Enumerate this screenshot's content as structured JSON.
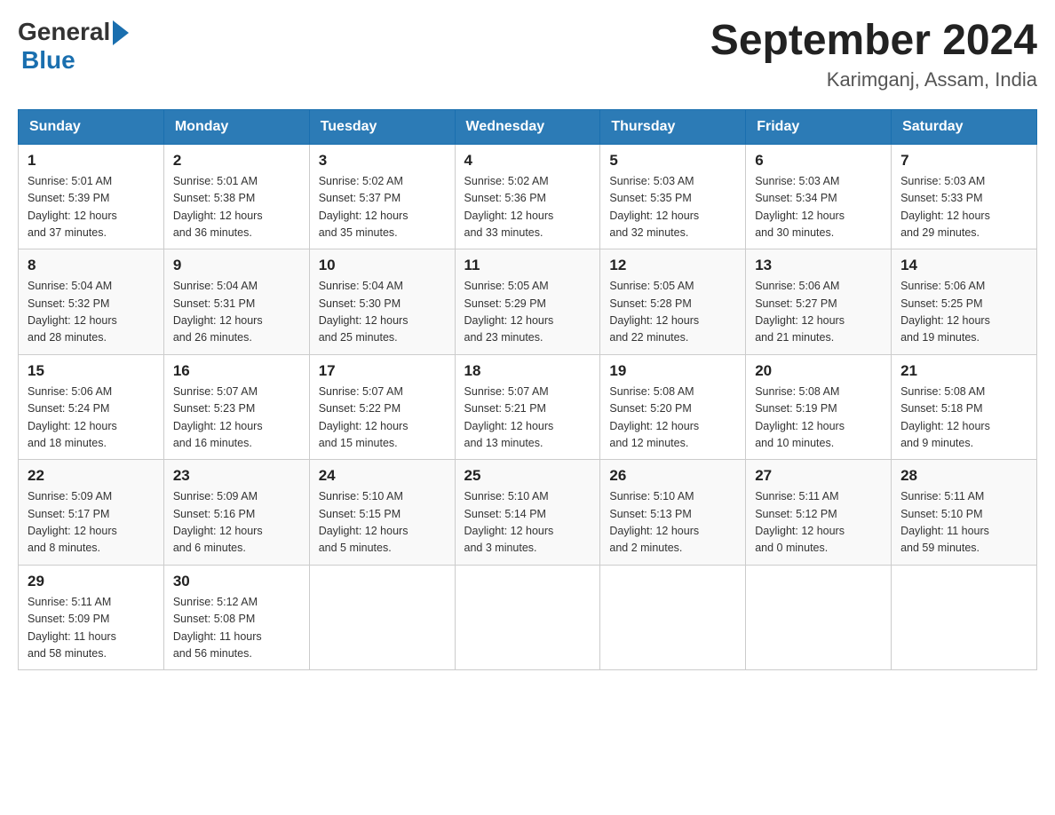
{
  "header": {
    "logo_general": "General",
    "logo_blue": "Blue",
    "month_title": "September 2024",
    "location": "Karimganj, Assam, India"
  },
  "days_of_week": [
    "Sunday",
    "Monday",
    "Tuesday",
    "Wednesday",
    "Thursday",
    "Friday",
    "Saturday"
  ],
  "weeks": [
    [
      {
        "day": "1",
        "sunrise": "5:01 AM",
        "sunset": "5:39 PM",
        "daylight": "12 hours and 37 minutes."
      },
      {
        "day": "2",
        "sunrise": "5:01 AM",
        "sunset": "5:38 PM",
        "daylight": "12 hours and 36 minutes."
      },
      {
        "day": "3",
        "sunrise": "5:02 AM",
        "sunset": "5:37 PM",
        "daylight": "12 hours and 35 minutes."
      },
      {
        "day": "4",
        "sunrise": "5:02 AM",
        "sunset": "5:36 PM",
        "daylight": "12 hours and 33 minutes."
      },
      {
        "day": "5",
        "sunrise": "5:03 AM",
        "sunset": "5:35 PM",
        "daylight": "12 hours and 32 minutes."
      },
      {
        "day": "6",
        "sunrise": "5:03 AM",
        "sunset": "5:34 PM",
        "daylight": "12 hours and 30 minutes."
      },
      {
        "day": "7",
        "sunrise": "5:03 AM",
        "sunset": "5:33 PM",
        "daylight": "12 hours and 29 minutes."
      }
    ],
    [
      {
        "day": "8",
        "sunrise": "5:04 AM",
        "sunset": "5:32 PM",
        "daylight": "12 hours and 28 minutes."
      },
      {
        "day": "9",
        "sunrise": "5:04 AM",
        "sunset": "5:31 PM",
        "daylight": "12 hours and 26 minutes."
      },
      {
        "day": "10",
        "sunrise": "5:04 AM",
        "sunset": "5:30 PM",
        "daylight": "12 hours and 25 minutes."
      },
      {
        "day": "11",
        "sunrise": "5:05 AM",
        "sunset": "5:29 PM",
        "daylight": "12 hours and 23 minutes."
      },
      {
        "day": "12",
        "sunrise": "5:05 AM",
        "sunset": "5:28 PM",
        "daylight": "12 hours and 22 minutes."
      },
      {
        "day": "13",
        "sunrise": "5:06 AM",
        "sunset": "5:27 PM",
        "daylight": "12 hours and 21 minutes."
      },
      {
        "day": "14",
        "sunrise": "5:06 AM",
        "sunset": "5:25 PM",
        "daylight": "12 hours and 19 minutes."
      }
    ],
    [
      {
        "day": "15",
        "sunrise": "5:06 AM",
        "sunset": "5:24 PM",
        "daylight": "12 hours and 18 minutes."
      },
      {
        "day": "16",
        "sunrise": "5:07 AM",
        "sunset": "5:23 PM",
        "daylight": "12 hours and 16 minutes."
      },
      {
        "day": "17",
        "sunrise": "5:07 AM",
        "sunset": "5:22 PM",
        "daylight": "12 hours and 15 minutes."
      },
      {
        "day": "18",
        "sunrise": "5:07 AM",
        "sunset": "5:21 PM",
        "daylight": "12 hours and 13 minutes."
      },
      {
        "day": "19",
        "sunrise": "5:08 AM",
        "sunset": "5:20 PM",
        "daylight": "12 hours and 12 minutes."
      },
      {
        "day": "20",
        "sunrise": "5:08 AM",
        "sunset": "5:19 PM",
        "daylight": "12 hours and 10 minutes."
      },
      {
        "day": "21",
        "sunrise": "5:08 AM",
        "sunset": "5:18 PM",
        "daylight": "12 hours and 9 minutes."
      }
    ],
    [
      {
        "day": "22",
        "sunrise": "5:09 AM",
        "sunset": "5:17 PM",
        "daylight": "12 hours and 8 minutes."
      },
      {
        "day": "23",
        "sunrise": "5:09 AM",
        "sunset": "5:16 PM",
        "daylight": "12 hours and 6 minutes."
      },
      {
        "day": "24",
        "sunrise": "5:10 AM",
        "sunset": "5:15 PM",
        "daylight": "12 hours and 5 minutes."
      },
      {
        "day": "25",
        "sunrise": "5:10 AM",
        "sunset": "5:14 PM",
        "daylight": "12 hours and 3 minutes."
      },
      {
        "day": "26",
        "sunrise": "5:10 AM",
        "sunset": "5:13 PM",
        "daylight": "12 hours and 2 minutes."
      },
      {
        "day": "27",
        "sunrise": "5:11 AM",
        "sunset": "5:12 PM",
        "daylight": "12 hours and 0 minutes."
      },
      {
        "day": "28",
        "sunrise": "5:11 AM",
        "sunset": "5:10 PM",
        "daylight": "11 hours and 59 minutes."
      }
    ],
    [
      {
        "day": "29",
        "sunrise": "5:11 AM",
        "sunset": "5:09 PM",
        "daylight": "11 hours and 58 minutes."
      },
      {
        "day": "30",
        "sunrise": "5:12 AM",
        "sunset": "5:08 PM",
        "daylight": "11 hours and 56 minutes."
      },
      null,
      null,
      null,
      null,
      null
    ]
  ],
  "labels": {
    "sunrise_prefix": "Sunrise: ",
    "sunset_prefix": "Sunset: ",
    "daylight_prefix": "Daylight: "
  }
}
